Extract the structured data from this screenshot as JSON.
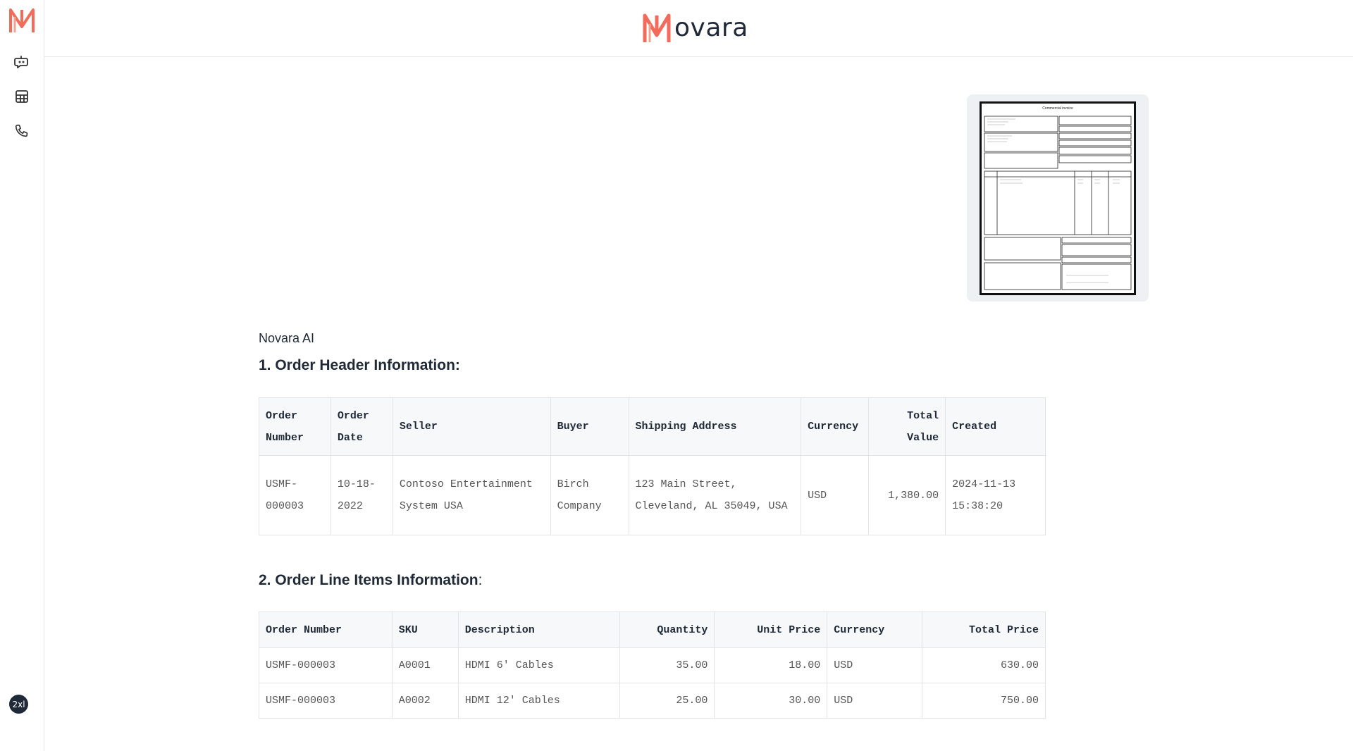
{
  "app": {
    "brand_text": "ovara",
    "logo_icon": "novara-n-logo",
    "accent_color": "#f26b5b"
  },
  "sidebar": {
    "items": [
      {
        "icon": "chat-bot-icon"
      },
      {
        "icon": "table-grid-icon"
      },
      {
        "icon": "phone-icon"
      }
    ],
    "user_badge": "2xl"
  },
  "attachment": {
    "invoice_title": "Commercial invoice"
  },
  "message": {
    "sender": "Novara AI",
    "section1_title": "1. Order Header Information:",
    "section2_title": "2. Order Line Items Information",
    "section2_suffix": ":"
  },
  "header_table": {
    "columns": [
      "Order Number",
      "Order Date",
      "Seller",
      "Buyer",
      "Shipping Address",
      "Currency",
      "Total Value",
      "Created"
    ],
    "rows": [
      [
        "USMF-000003",
        "10-18-2022",
        "Contoso Entertainment System USA",
        "Birch Company",
        "123 Main Street, Cleveland, AL 35049, USA",
        "USD",
        "1,380.00",
        "2024-11-13 15:38:20"
      ]
    ]
  },
  "lines_table": {
    "columns": [
      "Order Number",
      "SKU",
      "Description",
      "Quantity",
      "Unit Price",
      "Currency",
      "Total Price"
    ],
    "rows": [
      [
        "USMF-000003",
        "A0001",
        "HDMI 6' Cables",
        "35.00",
        "18.00",
        "USD",
        "630.00"
      ],
      [
        "USMF-000003",
        "A0002",
        "HDMI 12' Cables",
        "25.00",
        "30.00",
        "USD",
        "750.00"
      ]
    ]
  }
}
